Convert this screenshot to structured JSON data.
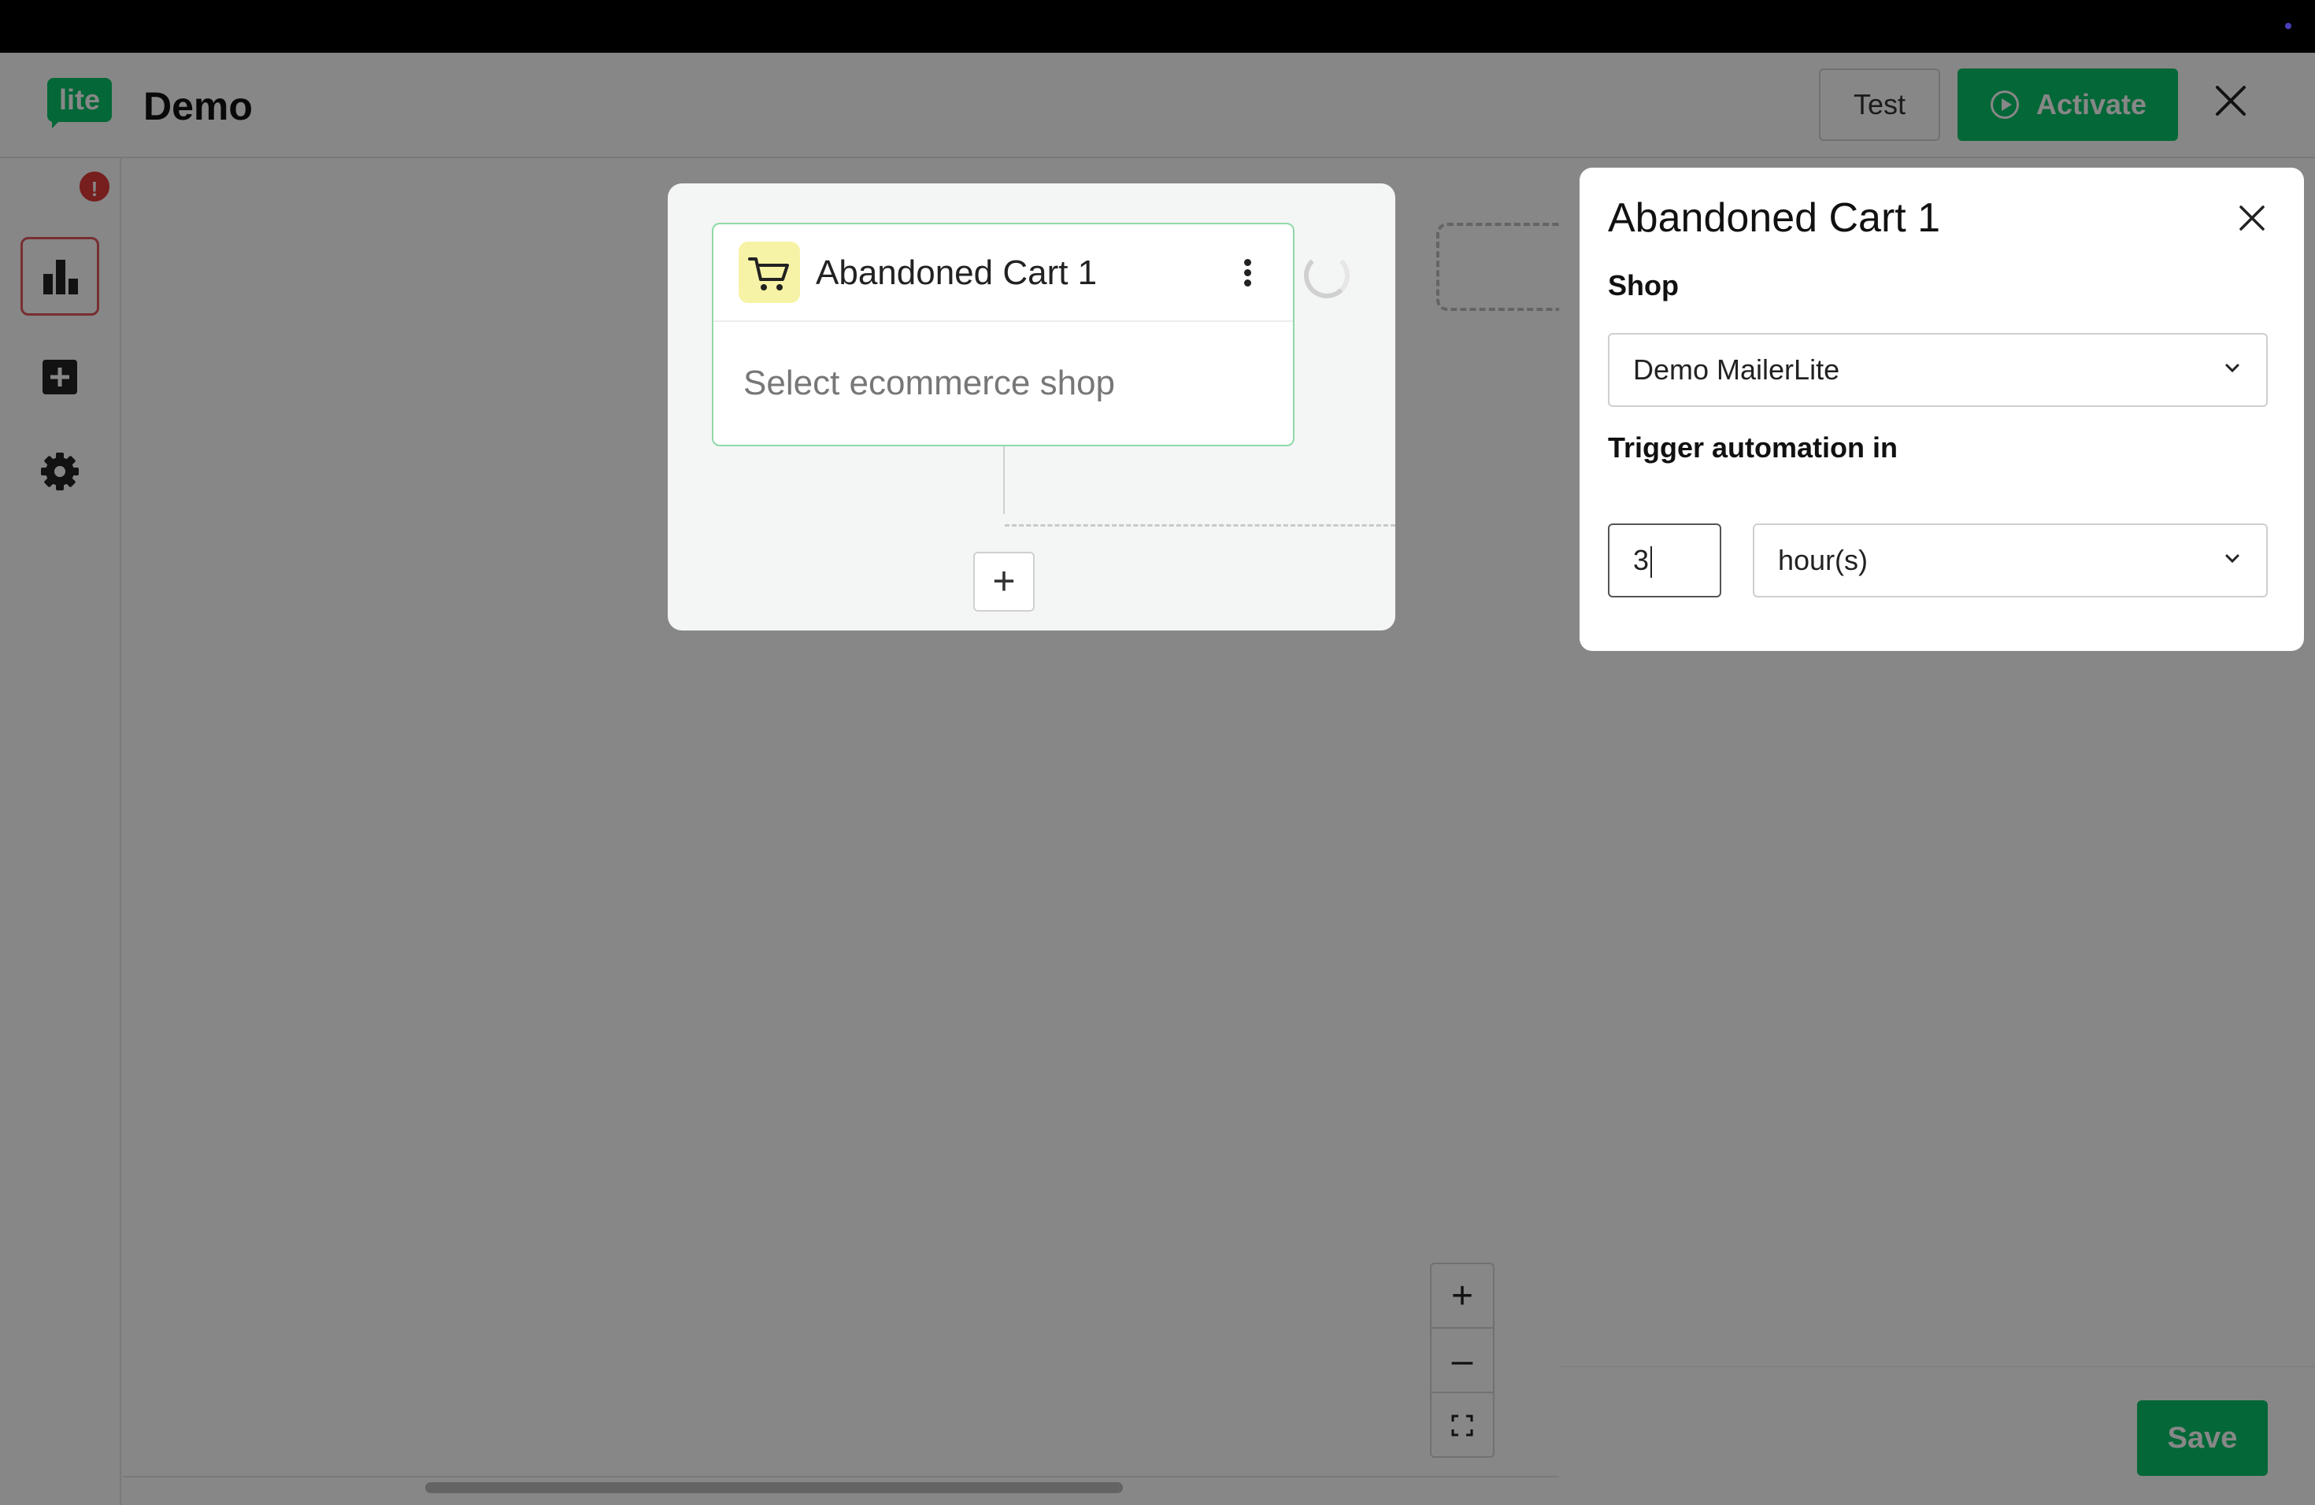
{
  "header": {
    "logo_text": "lite",
    "app_title": "Demo",
    "test_label": "Test",
    "activate_label": "Activate"
  },
  "sidebar": {
    "items": [
      {
        "icon": "bar-chart-icon",
        "badge": "!"
      },
      {
        "icon": "plus-square-icon"
      },
      {
        "icon": "gear-icon"
      }
    ]
  },
  "canvas": {
    "node": {
      "title": "Abandoned Cart 1",
      "placeholder": "Select ecommerce shop",
      "icon": "cart-icon",
      "icon_bg": "#f7f3a6",
      "border_color": "#8fd9a8"
    },
    "zoom": {
      "zoom_in": "+",
      "zoom_out": "–",
      "fit_icon": "fit-screen-icon"
    }
  },
  "panel": {
    "title": "Abandoned Cart 1",
    "shop_label": "Shop",
    "shop_value": "Demo MailerLite",
    "trigger_label": "Trigger automation in",
    "trigger_amount": "3",
    "trigger_unit": "hour(s)",
    "save_label": "Save"
  },
  "colors": {
    "brand_green": "#09c269",
    "badge_red": "#e03a3a",
    "overlay": "rgba(0,0,0,0.47)"
  }
}
